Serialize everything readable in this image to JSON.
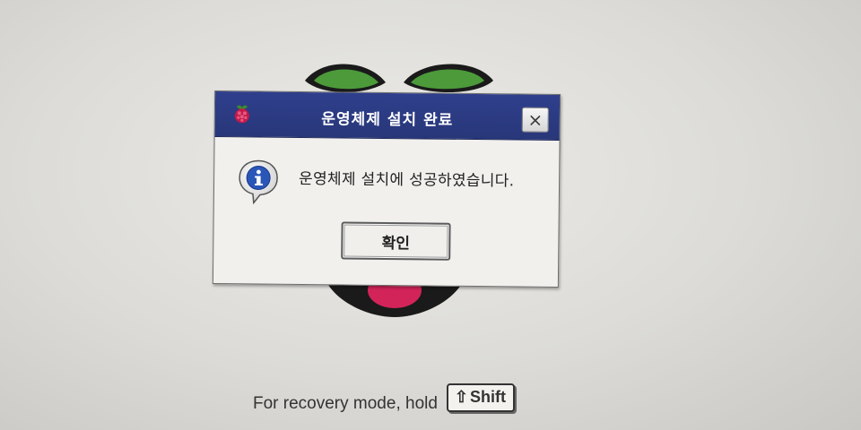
{
  "dialog": {
    "title": "운영체제 설치 완료",
    "message": "운영체제 설치에 성공하였습니다.",
    "ok_label": "확인",
    "close_glyph": "×"
  },
  "footer": {
    "text": "For recovery mode, hold",
    "key_label": "Shift",
    "key_icon": "⇧"
  },
  "icons": {
    "title_icon": "raspberry-icon",
    "message_icon": "info-icon"
  },
  "colors": {
    "titlebar": "#2f3f8c",
    "dialog_bg": "#f1f0ed",
    "background": "#e2e1de"
  }
}
